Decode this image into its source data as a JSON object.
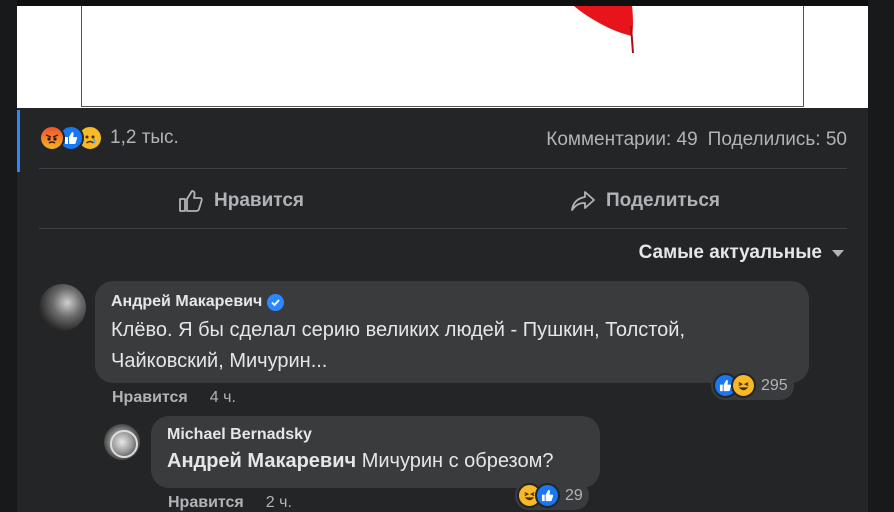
{
  "post": {
    "reaction_icons": [
      "angry-icon",
      "like-icon",
      "sad-icon"
    ],
    "reaction_count": "1,2 тыс.",
    "comments_label": "Комментарии: 49",
    "shares_label": "Поделились: 50"
  },
  "actions": {
    "like_label": "Нравится",
    "share_label": "Поделиться"
  },
  "sort": {
    "label": "Самые актуальные"
  },
  "comments": [
    {
      "author": "Андрей Макаревич",
      "verified": true,
      "text": "Клёво. Я бы сделал серию великих людей - Пушкин, Толстой, Чайковский, Мичурин...",
      "like_label": "Нравится",
      "time": "4 ч.",
      "reaction_icons": [
        "like-icon",
        "haha-icon"
      ],
      "reaction_count": "295"
    },
    {
      "author": "Michael Bernadsky",
      "mention": "Андрей Макаревич",
      "text": "Мичурин с обрезом?",
      "like_label": "Нравится",
      "time": "2 ч.",
      "reaction_icons": [
        "haha-icon",
        "like-icon"
      ],
      "reaction_count": "29"
    }
  ],
  "colors": {
    "background": "#18191a",
    "card": "#242526",
    "bubble": "#3a3b3c",
    "text_primary": "#e4e6eb",
    "text_secondary": "#b0b3b8",
    "accent": "#2d88ff"
  }
}
